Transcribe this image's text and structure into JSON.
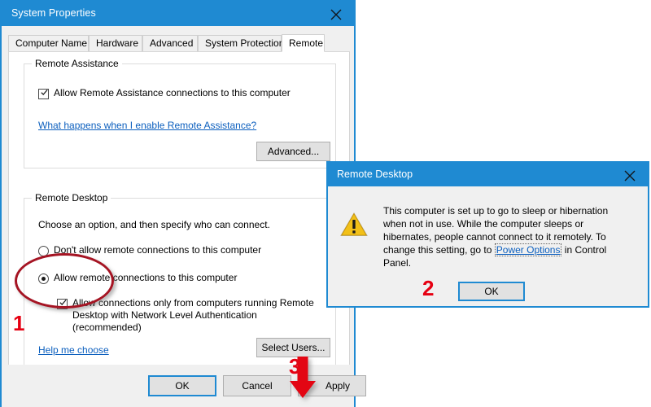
{
  "system_properties": {
    "title": "System Properties",
    "close_icon": "close-icon",
    "tabs": [
      {
        "label": "Computer Name",
        "active": false
      },
      {
        "label": "Hardware",
        "active": false
      },
      {
        "label": "Advanced",
        "active": false
      },
      {
        "label": "System Protection",
        "active": false
      },
      {
        "label": "Remote",
        "active": true
      }
    ],
    "remote_assistance": {
      "group_label": "Remote Assistance",
      "checkbox_label": "Allow Remote Assistance connections to this computer",
      "checkbox_checked": true,
      "link": "What happens when I enable Remote Assistance?",
      "advanced_button": "Advanced..."
    },
    "remote_desktop": {
      "group_label": "Remote Desktop",
      "instruction": "Choose an option, and then specify who can connect.",
      "options": [
        {
          "label": "Don't allow remote connections to this computer",
          "selected": false
        },
        {
          "label": "Allow remote connections to this computer",
          "selected": true
        }
      ],
      "nla_checkbox_label": "Allow connections only from computers running Remote Desktop with Network Level Authentication (recommended)",
      "nla_checked": true,
      "help_link": "Help me choose",
      "select_users_button": "Select Users..."
    },
    "command_buttons": [
      {
        "label": "OK",
        "default": true
      },
      {
        "label": "Cancel",
        "default": false
      },
      {
        "label": "Apply",
        "default": false
      }
    ]
  },
  "message_box": {
    "title": "Remote Desktop",
    "close_icon": "close-icon",
    "icon": "warning-triangle-icon",
    "text_part1": "This computer is set up to go to sleep or hibernation when not in use. While the computer sleeps or hibernates, people cannot connect to it remotely. To change this setting, go to ",
    "link_text": "Power Options",
    "text_part2": " in Control Panel.",
    "ok_button": "OK"
  },
  "annotations": {
    "marker_1": "1",
    "marker_2": "2",
    "marker_3": "3",
    "ellipse_color": "#a51423",
    "marker_color": "#e60012",
    "arrow_color": "#e30613",
    "ellipse_target": "allow-remote-connections-radio",
    "arrow_target": "apply-button"
  },
  "theme": {
    "titlebar_color": "#1f8ad2",
    "window_background": "#f0f0f0",
    "page_background": "#ffffff",
    "link_color": "#0c5fbe",
    "button_face": "#e1e1e1"
  }
}
